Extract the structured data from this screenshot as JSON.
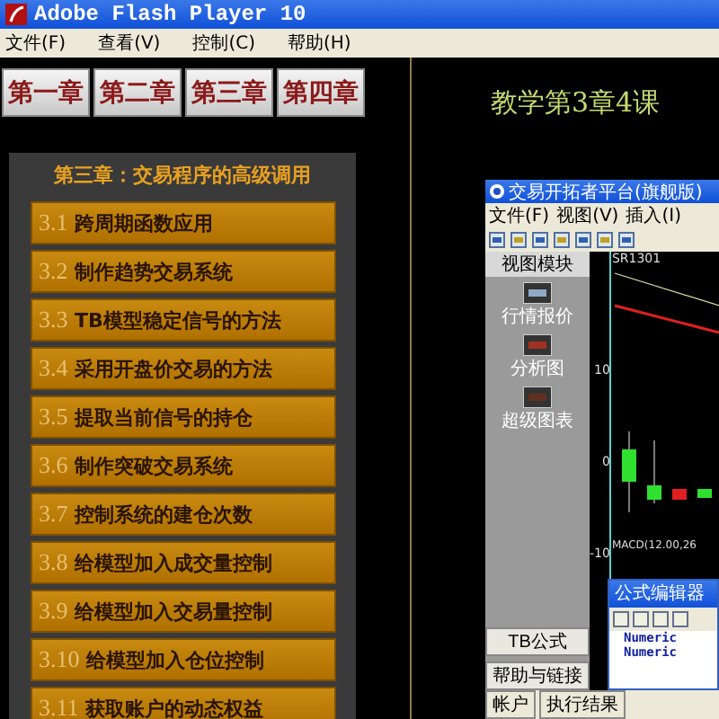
{
  "window": {
    "title": "Adobe Flash Player 10"
  },
  "menu": [
    "文件(F)",
    "查看(V)",
    "控制(C)",
    "帮助(H)"
  ],
  "chapter_tabs": [
    "第一章",
    "第二章",
    "第三章",
    "第四章"
  ],
  "lesson_title": "教学第3章4课",
  "section": {
    "heading": "第三章：交易程序的高级调用",
    "lessons": [
      {
        "number": "3.1",
        "title": "跨周期函数应用"
      },
      {
        "number": "3.2",
        "title": "制作趋势交易系统"
      },
      {
        "number": "3.3",
        "title": "TB模型稳定信号的方法"
      },
      {
        "number": "3.4",
        "title": "采用开盘价交易的方法"
      },
      {
        "number": "3.5",
        "title": "提取当前信号的持仓"
      },
      {
        "number": "3.6",
        "title": "制作突破交易系统"
      },
      {
        "number": "3.7",
        "title": "控制系统的建仓次数"
      },
      {
        "number": "3.8",
        "title": "给模型加入成交量控制"
      },
      {
        "number": "3.9",
        "title": "给模型加入交易量控制"
      },
      {
        "number": "3.10",
        "title": "给模型加入仓位控制"
      },
      {
        "number": "3.11",
        "title": "获取账户的动态权益"
      }
    ]
  },
  "recording": {
    "title": "交易开拓者平台(旗舰版)",
    "menu": [
      "文件(F)",
      "视图(V)",
      "插入(I)"
    ],
    "panel": {
      "heading": "视图模块",
      "modules": [
        "行情报价",
        "分析图",
        "超级图表"
      ],
      "buttons": [
        "TB公式",
        "帮助与链接"
      ]
    },
    "footer": [
      "帐户",
      "执行结果"
    ],
    "chart": {
      "symbol": "SR1301",
      "ticks": [
        "10",
        "0",
        "-10"
      ],
      "indicator": "MACD(12.00,26"
    },
    "editor": {
      "title": "公式编辑器",
      "code_lines": [
        "Numeric",
        "Numeric"
      ]
    }
  }
}
